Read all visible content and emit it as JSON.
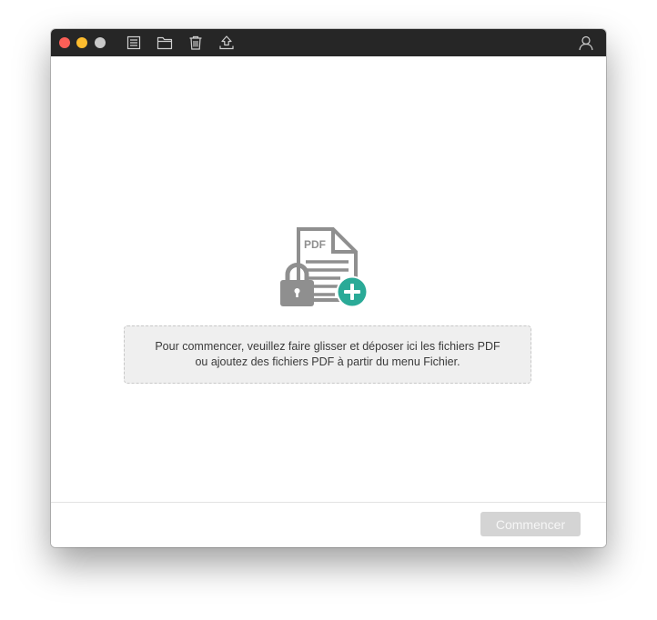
{
  "titlebar": {
    "background": "#262626",
    "window_controls": [
      {
        "name": "close",
        "color": "#fc5f57"
      },
      {
        "name": "minimize",
        "color": "#fdbc2e"
      },
      {
        "name": "zoom",
        "color": "#c9c9c9"
      }
    ],
    "toolbar_icons": [
      "list-icon",
      "folder-icon",
      "trash-icon",
      "upload-icon"
    ],
    "account_icon": "user-icon"
  },
  "main": {
    "hero_icon": {
      "name": "pdf-lock-add-icon",
      "label": "PDF",
      "gray": "#8f8f8f",
      "accent": "#2aaa97"
    },
    "drop_zone": {
      "line1": "Pour commencer, veuillez faire glisser et déposer ici les fichiers PDF",
      "line2": "ou ajoutez des fichiers PDF à partir du menu Fichier."
    }
  },
  "footer": {
    "start_label": "Commencer"
  }
}
